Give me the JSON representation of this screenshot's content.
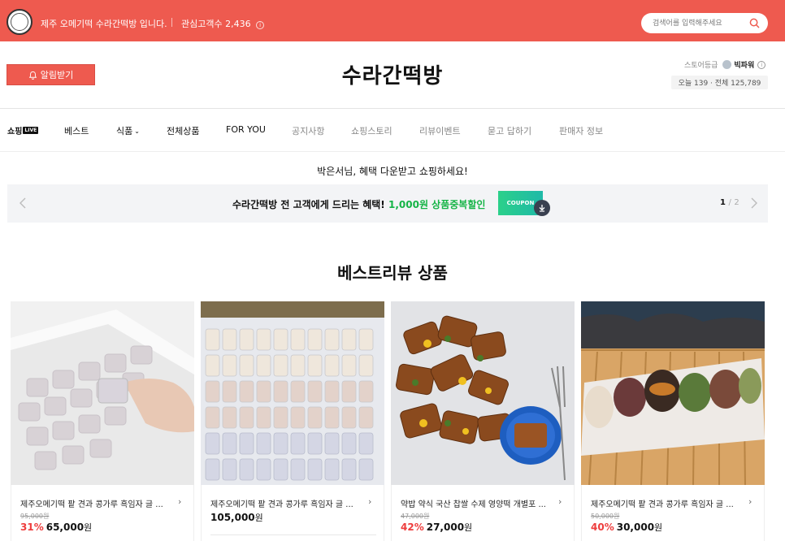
{
  "topbar": {
    "logo_text": "수라간떡방",
    "store_description": "제주 오메기떡 수라간떡방 입니다.",
    "interest_label": "관심고객수",
    "interest_count": "2,436",
    "search_placeholder": "검색어를 입력해주세요"
  },
  "header": {
    "notify_label": "알림받기",
    "store_name": "수라간떡방",
    "grade_label": "스토어등급",
    "grade_value": "빅파워",
    "visits_text": "오늘 139 · 전체 125,789"
  },
  "nav": {
    "live_logo": "쇼핑",
    "live_badge": "LIVE",
    "items": [
      "베스트",
      "식품",
      "전체상품",
      "FOR YOU",
      "공지사항",
      "쇼핑스토리",
      "리뷰이벤트",
      "묻고 답하기",
      "판매자 정보"
    ]
  },
  "welcome": "박은서님, 혜택 다운받고 쇼핑하세요!",
  "banner": {
    "text": "수라간떡방 전 고객에게 드리는 혜택!",
    "highlight": "1,000원 상품중복할인",
    "coupon_label": "COUPON",
    "page_current": "1",
    "page_sep": "/",
    "page_total": "2"
  },
  "section_title": "베스트리뷰 상품",
  "products": [
    {
      "name": "제주오메기떡 팥 견과 콩가루 흑임자 글 ...",
      "original": "95,000원",
      "discount": "31%",
      "price": "65,000",
      "won": "원"
    },
    {
      "name": "제주오메기떡 팥 견과 콩가루 흑임자 글 ...",
      "original": "",
      "discount": "",
      "price": "105,000",
      "won": "원"
    },
    {
      "name": "약밥 약식 국산 찹쌀 수제 영양떡 개별포 ...",
      "original": "47,000원",
      "discount": "42%",
      "price": "27,000",
      "won": "원"
    },
    {
      "name": "제주오메기떡 팥 견과 콩가루 흑임자 글 ...",
      "original": "50,000원",
      "discount": "40%",
      "price": "30,000",
      "won": "원"
    }
  ],
  "colors": {
    "brand": "#ee5a4f",
    "green": "#15b446",
    "discount": "#ee3d3d"
  }
}
